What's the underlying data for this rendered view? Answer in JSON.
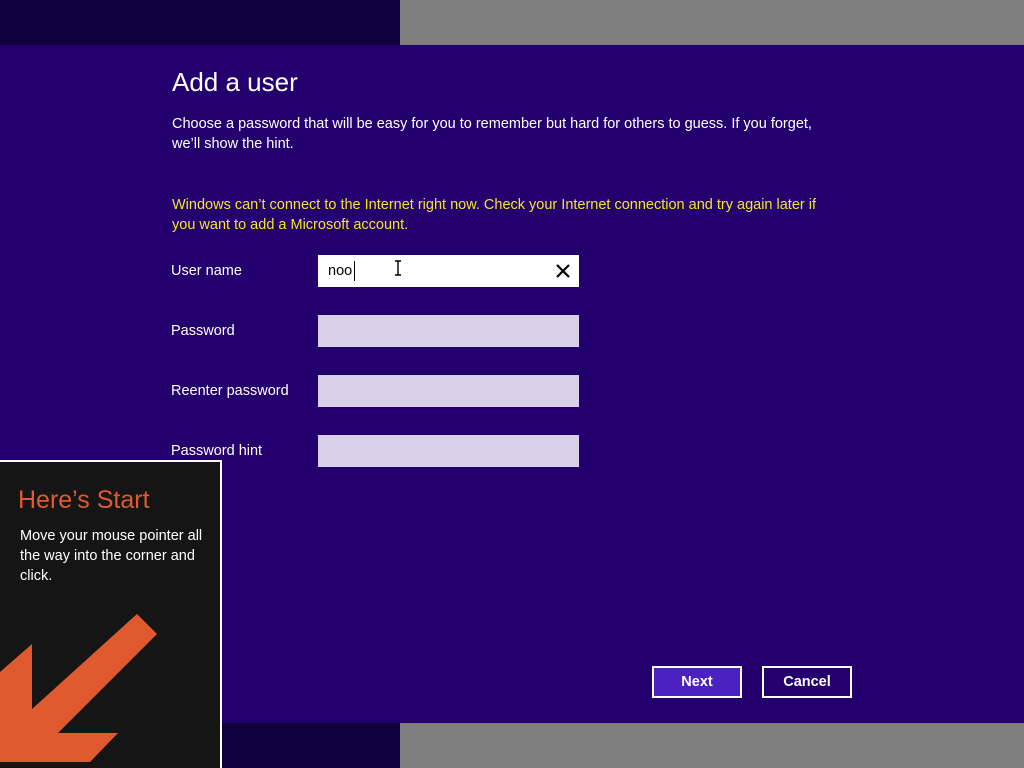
{
  "dialog": {
    "title": "Add a user",
    "description": "Choose a password that will be easy for you to remember but hard for others to guess. If you forget, we’ll show the hint.",
    "warning": "Windows can’t connect to the Internet right now. Check your Internet connection and try again later if you want to add a Microsoft account.",
    "fields": {
      "username": {
        "label": "User name",
        "value": "noo"
      },
      "password": {
        "label": "Password",
        "value": ""
      },
      "reenter": {
        "label": "Reenter password",
        "value": ""
      },
      "hint": {
        "label": "Password hint",
        "value": ""
      }
    },
    "buttons": {
      "next": "Next",
      "cancel": "Cancel"
    }
  },
  "start_tip": {
    "title": "Here’s Start",
    "body": "Move your mouse pointer all the way into the corner and click."
  },
  "icons": {
    "clear": "close-icon",
    "arrow": "arrow-down-left-icon",
    "cursor": "text-cursor-icon"
  },
  "colors": {
    "dialog_bg": "#23006e",
    "warning": "#f2e530",
    "accent_button": "#4a22c2",
    "tip_title": "#e05a2f",
    "tip_bg": "#151515"
  }
}
